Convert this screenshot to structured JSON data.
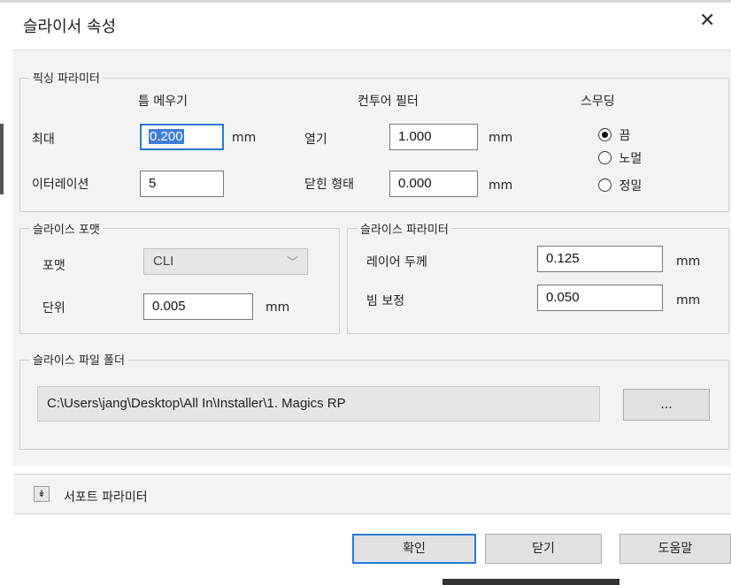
{
  "window": {
    "title": "슬라이서 속성",
    "close": "✕"
  },
  "pixing": {
    "legend": "픽싱 파라미터",
    "gap_header": "틈 메우기",
    "contour_header": "컨투어 필터",
    "smoothing_header": "스무딩",
    "max_label": "최대",
    "max_value": "0.200",
    "max_unit": "mm",
    "iter_label": "이터레이션",
    "iter_value": "5",
    "open_label": "열기",
    "open_value": "1.000",
    "open_unit": "mm",
    "closed_label": "닫힌 형태",
    "closed_value": "0.000",
    "closed_unit": "mm",
    "smoothing_options": [
      {
        "label": "끔",
        "selected": true
      },
      {
        "label": "노멀",
        "selected": false
      },
      {
        "label": "정밀",
        "selected": false
      }
    ]
  },
  "format": {
    "legend": "슬라이스 포맷",
    "format_label": "포맷",
    "format_value": "CLI",
    "unit_label": "단위",
    "unit_value": "0.005",
    "unit_unit": "mm"
  },
  "slice_params": {
    "legend": "슬라이스 파라미터",
    "layer_label": "레이어 두께",
    "layer_value": "0.125",
    "layer_unit": "mm",
    "beam_label": "빔 보정",
    "beam_value": "0.050",
    "beam_unit": "mm"
  },
  "folder": {
    "legend": "슬라이스 파일 폴더",
    "path": "C:\\Users\\jang\\Desktop\\All In\\Installer\\1. Magics RP",
    "browse_label": "..."
  },
  "support": {
    "toggle_icon": "chevron-double-down-icon",
    "label": "서포트 파라미터"
  },
  "buttons": {
    "ok": "확인",
    "close": "닫기",
    "help": "도움말"
  },
  "colors": {
    "accent": "#2a78d6",
    "panel": "#f3f3f3"
  }
}
